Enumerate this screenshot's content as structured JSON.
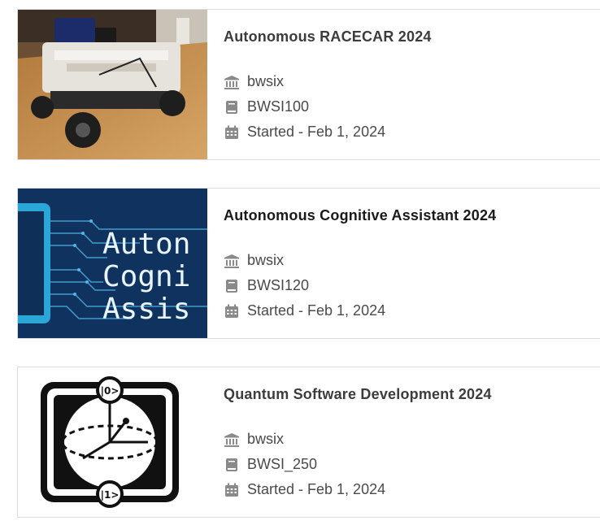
{
  "courses": [
    {
      "title": "Autonomous RACECAR 2024",
      "org": "bwsix",
      "code": "BWSI100",
      "started": "Started - Feb 1, 2024"
    },
    {
      "title": "Autonomous Cognitive Assistant 2024",
      "org": "bwsix",
      "code": "BWSI120",
      "started": "Started - Feb 1, 2024",
      "thumb_text": [
        "Auton",
        "Cogni",
        "Assis"
      ]
    },
    {
      "title": "Quantum Software Development 2024",
      "org": "bwsix",
      "code": "BWSI_250",
      "started": "Started - Feb 1, 2024",
      "thumb_labels": [
        "|0>",
        "|1>"
      ]
    }
  ],
  "icons": {
    "org": "institution-icon",
    "code": "book-icon",
    "date": "calendar-icon"
  },
  "colors": {
    "title": "#3c3c3c",
    "meta_text": "#4a4a4a",
    "icon": "#8a8a8a",
    "card_border": "#dcdcdc",
    "thumb2_bg": "#0e2f57",
    "thumb2_text": "#e8f4ff"
  }
}
